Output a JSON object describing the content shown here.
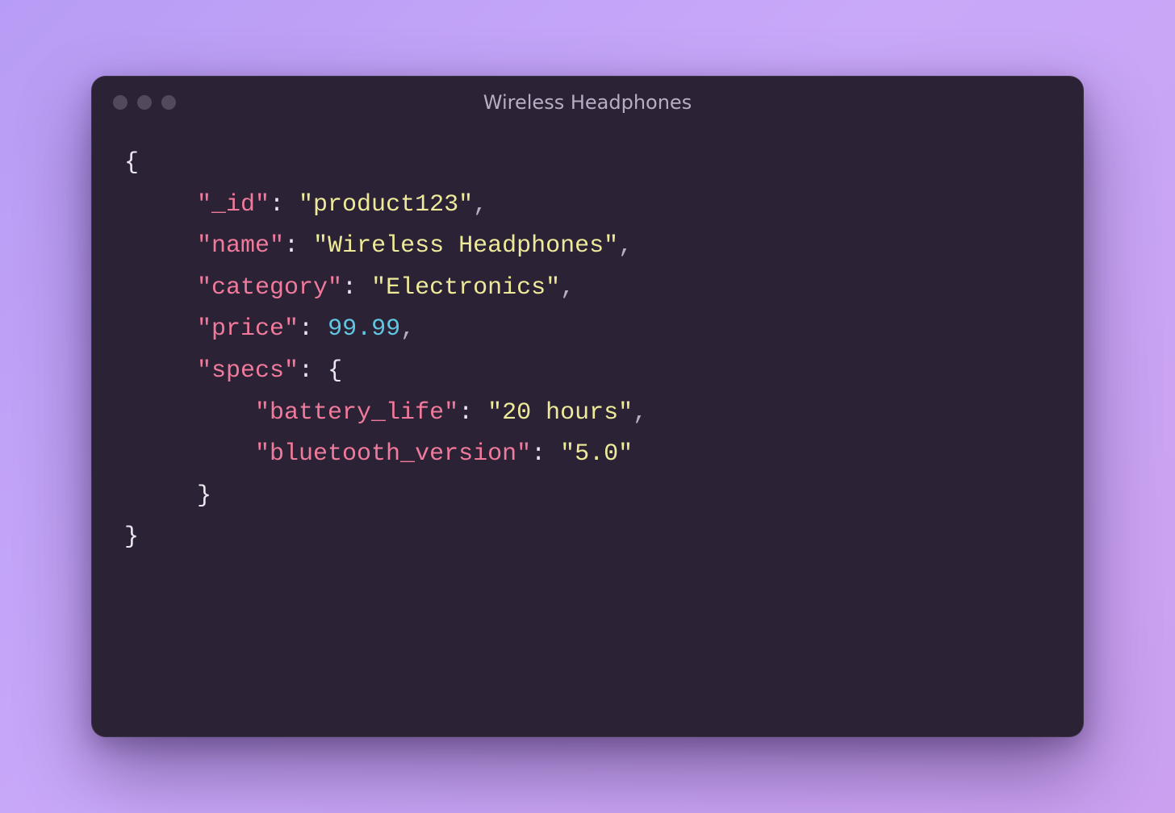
{
  "window": {
    "title": "Wireless Headphones"
  },
  "code": {
    "keys": {
      "id": "\"_id\"",
      "name": "\"name\"",
      "category": "\"category\"",
      "price": "\"price\"",
      "specs": "\"specs\"",
      "battery_life": "\"battery_life\"",
      "bluetooth_version": "\"bluetooth_version\""
    },
    "values": {
      "id": "\"product123\"",
      "name": "\"Wireless Headphones\"",
      "category": "\"Electronics\"",
      "price": "99.99",
      "battery_life": "\"20 hours\"",
      "bluetooth_version": "\"5.0\""
    },
    "punct": {
      "open_brace": "{",
      "close_brace": "}",
      "colon_sp": ": ",
      "comma": ","
    }
  }
}
